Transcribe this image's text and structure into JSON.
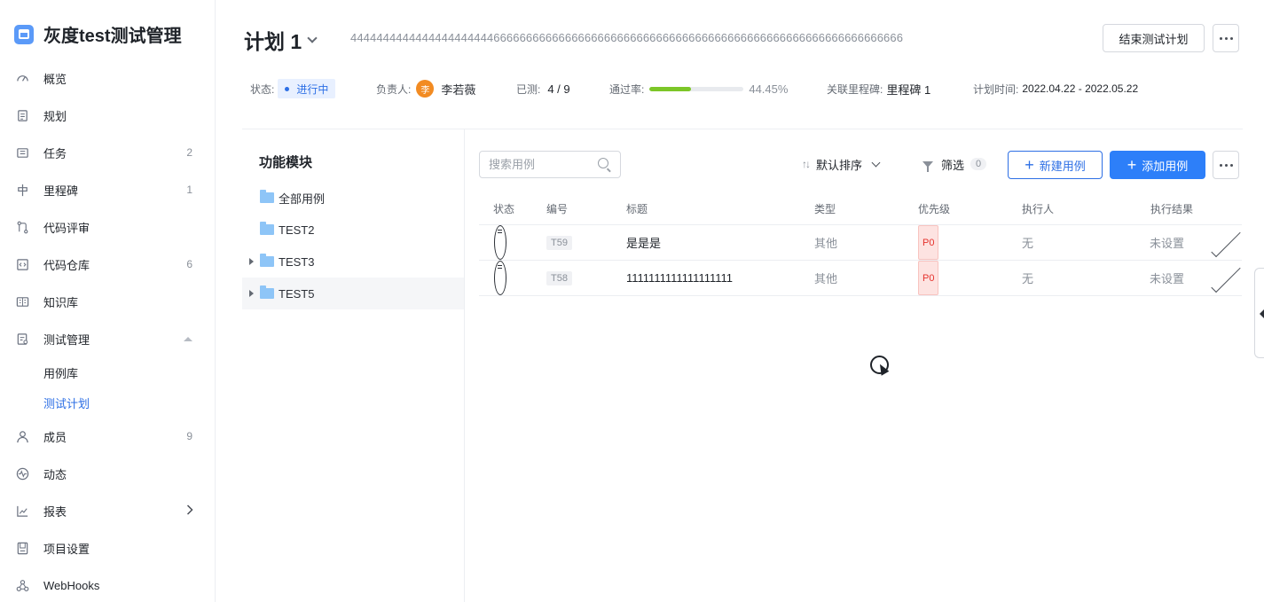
{
  "project": {
    "name": "灰度test测试管理",
    "icon": "project-icon"
  },
  "nav": [
    {
      "label": "概览",
      "icon": "dashboard-icon",
      "count": ""
    },
    {
      "label": "规划",
      "icon": "plan-icon",
      "count": ""
    },
    {
      "label": "任务",
      "icon": "task-icon",
      "count": "2"
    },
    {
      "label": "里程碑",
      "icon": "milestone-icon",
      "count": "1"
    },
    {
      "label": "代码评审",
      "icon": "code-review-icon",
      "count": ""
    },
    {
      "label": "代码仓库",
      "icon": "repo-icon",
      "count": "6"
    },
    {
      "label": "知识库",
      "icon": "wiki-icon",
      "count": ""
    },
    {
      "label": "测试管理",
      "icon": "test-icon",
      "count": ""
    },
    {
      "label": "成员",
      "icon": "members-icon",
      "count": "9"
    },
    {
      "label": "动态",
      "icon": "activity-icon",
      "count": ""
    },
    {
      "label": "报表",
      "icon": "report-icon",
      "count": ""
    },
    {
      "label": "项目设置",
      "icon": "settings-icon",
      "count": ""
    },
    {
      "label": "WebHooks",
      "icon": "webhooks-icon",
      "count": ""
    }
  ],
  "sub_nav": [
    {
      "label": "用例库",
      "active": false
    },
    {
      "label": "测试计划",
      "active": true
    }
  ],
  "plan": {
    "title": "计划 1",
    "description": "4444444444444444444444666666666666666666666666666666666666666666666666666666666666666",
    "end_button": "结束测试计划"
  },
  "meta": {
    "status_label": "状态:",
    "status_value": "进行中",
    "owner_label": "负责人:",
    "owner_avatar": "李",
    "owner_name": "李若薇",
    "tested_label": "已测:",
    "tested_value": "4 / 9",
    "pass_label": "通过率:",
    "pass_rate": "44.45%",
    "pass_fraction": 0.4445,
    "milestone_label": "关联里程碑:",
    "milestone_value": "里程碑 1",
    "time_label": "计划时间:",
    "time_value": "2022.04.22 - 2022.05.22"
  },
  "modules": {
    "title": "功能模块",
    "items": [
      {
        "label": "全部用例",
        "expandable": false
      },
      {
        "label": "TEST2",
        "expandable": false
      },
      {
        "label": "TEST3",
        "expandable": true
      },
      {
        "label": "TEST5",
        "expandable": true
      }
    ]
  },
  "toolbar": {
    "search_placeholder": "搜索用例",
    "sort_label": "默认排序",
    "filter_label": "筛选",
    "filter_count": "0",
    "new_case": "新建用例",
    "add_case": "添加用例"
  },
  "table": {
    "headers": [
      "状态",
      "编号",
      "标题",
      "类型",
      "优先级",
      "执行人",
      "执行结果"
    ],
    "rows": [
      {
        "id": "T59",
        "title": "是是是",
        "type": "其他",
        "priority": "P0",
        "assignee": "无",
        "result": "未设置"
      },
      {
        "id": "T58",
        "title": "1111111111111111111",
        "type": "其他",
        "priority": "P0",
        "assignee": "无",
        "result": "未设置"
      }
    ]
  },
  "colors": {
    "accent": "#2d7ff9",
    "progress": "#7cc628",
    "priority": "#e5322d",
    "folder": "#8ec5f7"
  }
}
